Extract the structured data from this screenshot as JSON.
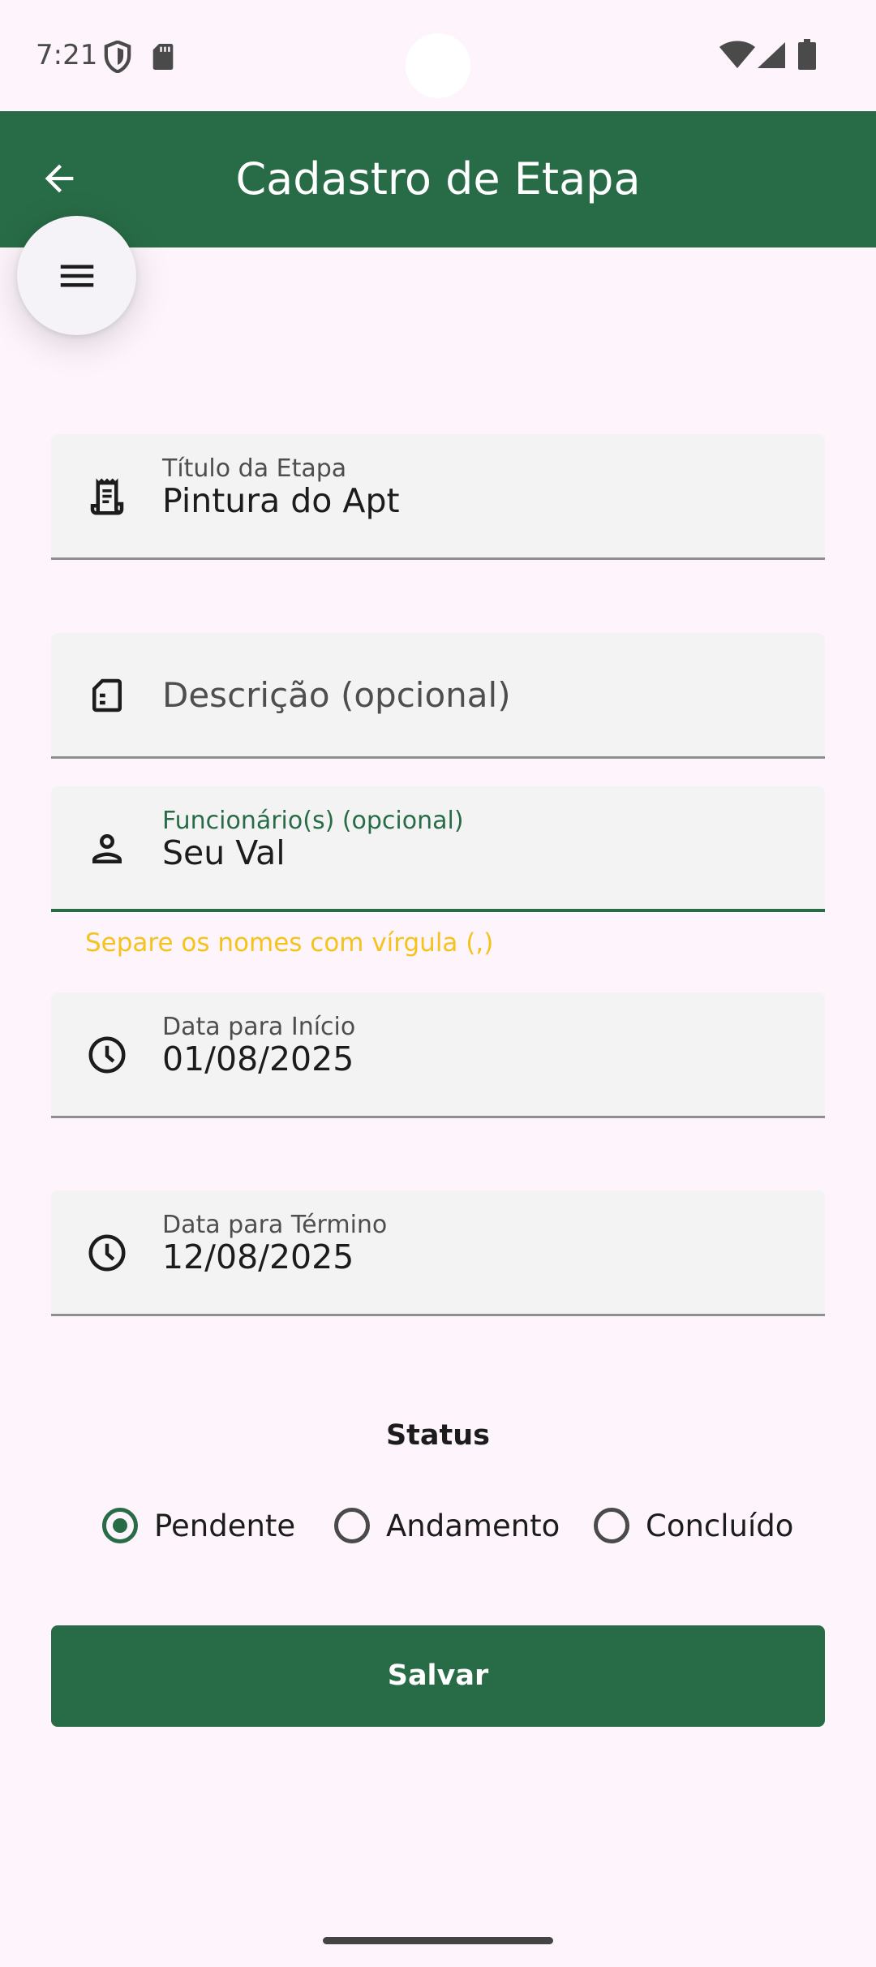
{
  "status_bar": {
    "time": "7:21"
  },
  "app_bar": {
    "title": "Cadastro de Etapa"
  },
  "fields": {
    "titulo": {
      "label": "Título da Etapa",
      "value": "Pintura do Apt",
      "icon": "receipt-icon"
    },
    "descricao": {
      "placeholder": "Descrição (opcional)",
      "icon": "description-icon"
    },
    "funcionarios": {
      "label": "Funcionário(s) (opcional)",
      "value": "Seu Val",
      "icon": "person-icon",
      "helper": "Separe os nomes com vírgula (,)"
    },
    "inicio": {
      "label": "Data para Início",
      "value": "01/08/2025",
      "icon": "clock-icon"
    },
    "termino": {
      "label": "Data para Término",
      "value": "12/08/2025",
      "icon": "clock-icon"
    }
  },
  "status_section": {
    "title": "Status",
    "options": [
      {
        "label": "Pendente",
        "selected": true
      },
      {
        "label": "Andamento",
        "selected": false
      },
      {
        "label": "Concluído",
        "selected": false
      }
    ]
  },
  "actions": {
    "save_label": "Salvar"
  },
  "colors": {
    "primary": "#286c47",
    "background": "#fdf5fb",
    "helper": "#f6c21c",
    "field_bg": "#f3f3f3"
  }
}
